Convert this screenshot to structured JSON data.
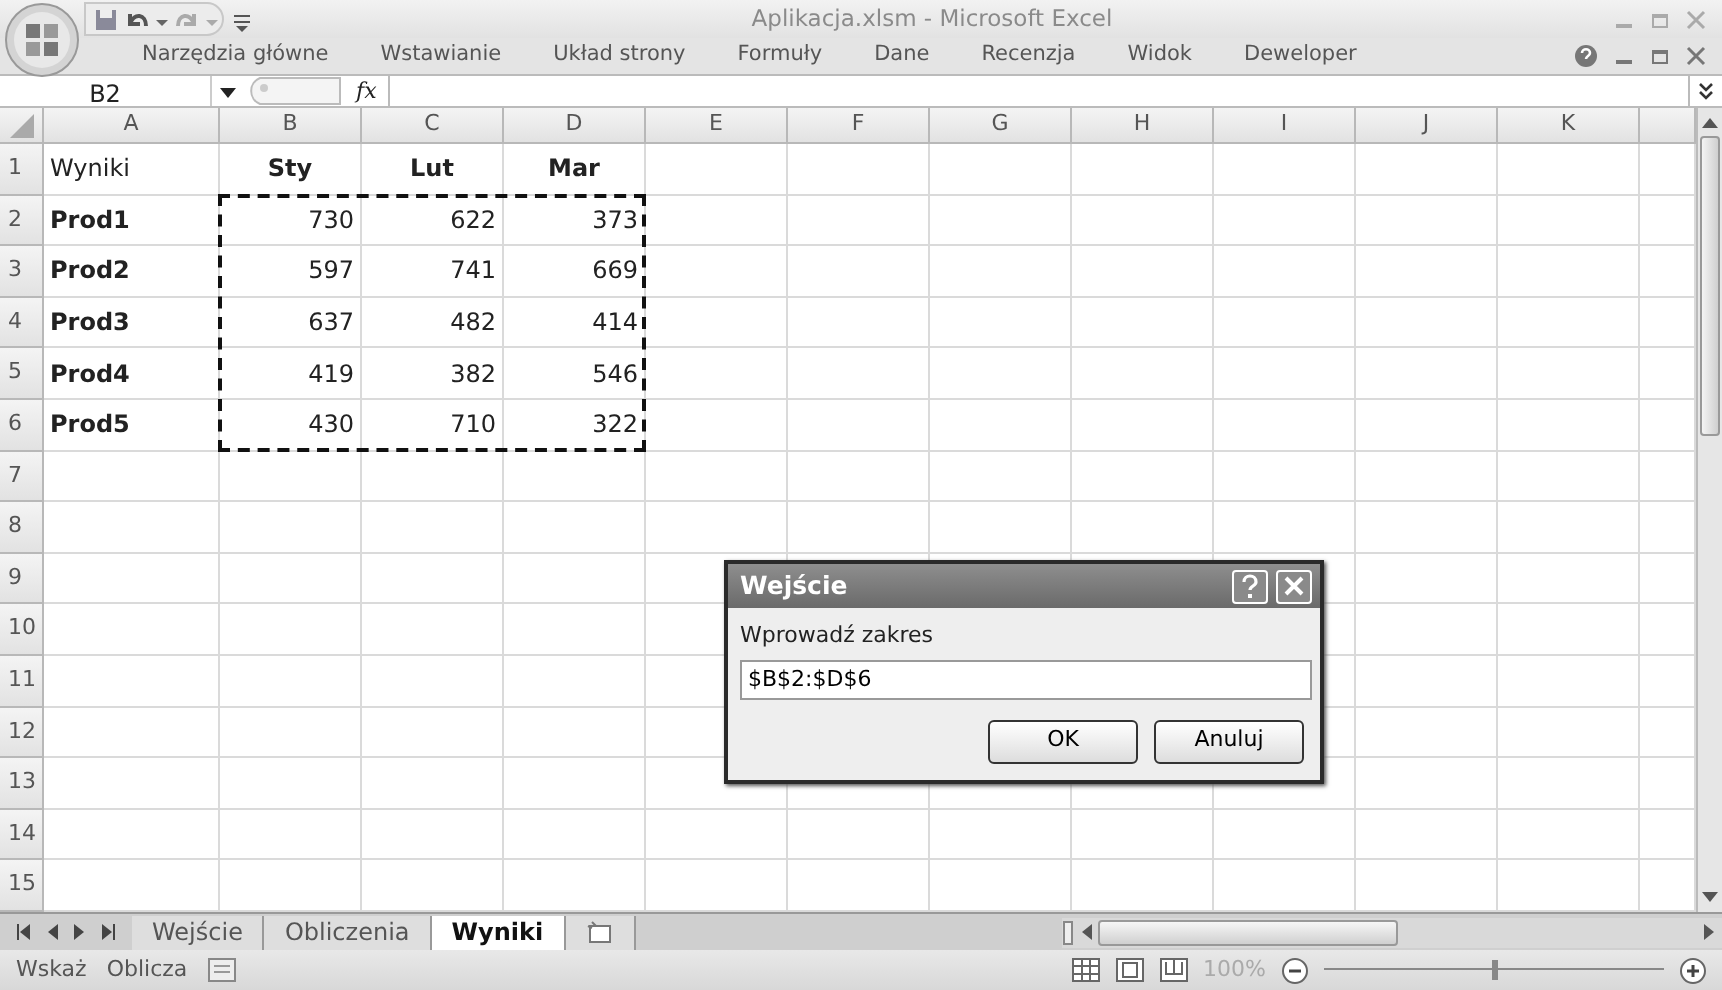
{
  "window": {
    "title": "Aplikacja.xlsm - Microsoft Excel"
  },
  "ribbon_tabs": [
    "Narzędzia główne",
    "Wstawianie",
    "Układ strony",
    "Formuły",
    "Dane",
    "Recenzja",
    "Widok",
    "Deweloper"
  ],
  "formula_bar": {
    "name_box": "B2",
    "function_label": "fx"
  },
  "columns": [
    "A",
    "B",
    "C",
    "D",
    "E",
    "F",
    "G",
    "H",
    "I",
    "J",
    "K"
  ],
  "copy_marquee": true,
  "rows": [
    {
      "number": "1",
      "cells": [
        {
          "text": "Wyniki",
          "kind": "text",
          "bold": false
        },
        {
          "text": "Sty",
          "kind": "heading",
          "bold": true
        },
        {
          "text": "Lut",
          "kind": "heading",
          "bold": true
        },
        {
          "text": "Mar",
          "kind": "heading",
          "bold": true
        }
      ]
    },
    {
      "number": "2",
      "cells": [
        {
          "text": "Prod1",
          "kind": "text",
          "bold": true
        },
        {
          "text": "730",
          "kind": "number",
          "bold": false
        },
        {
          "text": "622",
          "kind": "number",
          "bold": false
        },
        {
          "text": "373",
          "kind": "number",
          "bold": false
        }
      ]
    },
    {
      "number": "3",
      "cells": [
        {
          "text": "Prod2",
          "kind": "text",
          "bold": true
        },
        {
          "text": "597",
          "kind": "number",
          "bold": false
        },
        {
          "text": "741",
          "kind": "number",
          "bold": false
        },
        {
          "text": "669",
          "kind": "number",
          "bold": false
        }
      ]
    },
    {
      "number": "4",
      "cells": [
        {
          "text": "Prod3",
          "kind": "text",
          "bold": true
        },
        {
          "text": "637",
          "kind": "number",
          "bold": false
        },
        {
          "text": "482",
          "kind": "number",
          "bold": false
        },
        {
          "text": "414",
          "kind": "number",
          "bold": false
        }
      ]
    },
    {
      "number": "5",
      "cells": [
        {
          "text": "Prod4",
          "kind": "text",
          "bold": true
        },
        {
          "text": "419",
          "kind": "number",
          "bold": false
        },
        {
          "text": "382",
          "kind": "number",
          "bold": false
        },
        {
          "text": "546",
          "kind": "number",
          "bold": false
        }
      ]
    },
    {
      "number": "6",
      "cells": [
        {
          "text": "Prod5",
          "kind": "text",
          "bold": true
        },
        {
          "text": "430",
          "kind": "number",
          "bold": false
        },
        {
          "text": "710",
          "kind": "number",
          "bold": false
        },
        {
          "text": "322",
          "kind": "number",
          "bold": false
        }
      ]
    },
    {
      "number": "7",
      "cells": []
    },
    {
      "number": "8",
      "cells": []
    },
    {
      "number": "9",
      "cells": []
    },
    {
      "number": "10",
      "cells": []
    },
    {
      "number": "11",
      "cells": []
    },
    {
      "number": "12",
      "cells": []
    },
    {
      "number": "13",
      "cells": []
    },
    {
      "number": "14",
      "cells": []
    },
    {
      "number": "15",
      "cells": []
    }
  ],
  "sheet_tabs": [
    {
      "label": "Wejście",
      "selected": false
    },
    {
      "label": "Obliczenia",
      "selected": false
    },
    {
      "label": "Wyniki",
      "selected": true
    }
  ],
  "status_bar": {
    "items": [
      "Wskaż",
      "Oblicza"
    ],
    "zoom": "100%",
    "zoom_slider": {
      "level": 0.5
    }
  },
  "dialog": {
    "title": "Wejście",
    "label": "Wprowadź zakres",
    "value": "$B$2:$D$6",
    "buttons": [
      "OK",
      "Anuluj"
    ]
  }
}
